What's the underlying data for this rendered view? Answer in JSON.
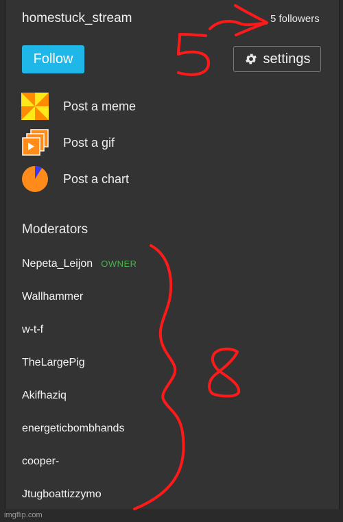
{
  "header": {
    "stream_name": "homestuck_stream",
    "followers": "5 followers",
    "follow_label": "Follow",
    "settings_label": "settings"
  },
  "posts": [
    {
      "label": "Post a meme",
      "icon": "meme-pinwheel-icon"
    },
    {
      "label": "Post a gif",
      "icon": "gif-stack-icon"
    },
    {
      "label": "Post a chart",
      "icon": "pie-chart-icon"
    }
  ],
  "moderators": {
    "title": "Moderators",
    "owner_badge": "OWNER",
    "list": [
      "Nepeta_Leijon",
      "Wallhammer",
      "w-t-f",
      "TheLargePig",
      "Akifhaziq",
      "energeticbombhands",
      "cooper-",
      "Jtugboattizzymo"
    ]
  },
  "annotations": {
    "followers_count_scribble": "5",
    "moderators_count_scribble": "8"
  },
  "watermark": "imgflip.com",
  "colors": {
    "background": "#333333",
    "follow_button": "#1fb7e8",
    "owner_badge": "#4caf50",
    "scribble": "#ff1a1a"
  }
}
